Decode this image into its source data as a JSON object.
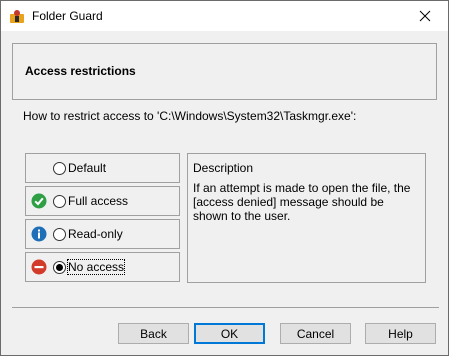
{
  "window": {
    "title": "Folder Guard"
  },
  "header": {
    "title": "Access restrictions"
  },
  "question": "How to restrict access to 'C:\\Windows\\System32\\Taskmgr.exe':",
  "options": [
    {
      "label": "Default",
      "icon": "none",
      "checked": false
    },
    {
      "label": "Full access",
      "icon": "green-check-icon",
      "checked": false
    },
    {
      "label": "Read-only",
      "icon": "blue-info-icon",
      "checked": false
    },
    {
      "label": "No access",
      "icon": "red-minus-icon",
      "checked": true
    }
  ],
  "description": {
    "title": "Description",
    "text": "If an attempt is made to open the file, the [access denied] message should be shown to the user."
  },
  "buttons": {
    "back": "Back",
    "ok": "OK",
    "cancel": "Cancel",
    "help": "Help"
  },
  "colors": {
    "green": "#2e9f45",
    "blue": "#1f6fb8",
    "red": "#d23a2a",
    "accent": "#0078d7"
  }
}
